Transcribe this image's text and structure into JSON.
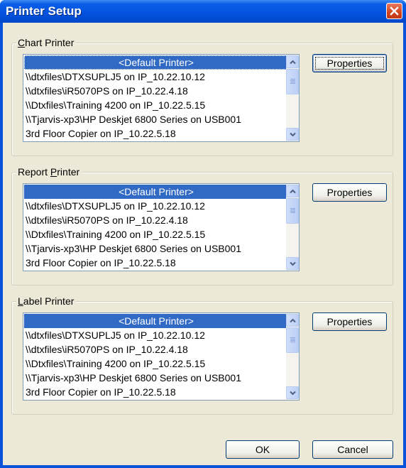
{
  "window": {
    "title": "Printer Setup"
  },
  "printers": [
    "<Default Printer>",
    "\\\\dtxfiles\\DTXSUPLJ5 on IP_10.22.10.12",
    "\\\\dtxfiles\\iR5070PS on IP_10.22.4.18",
    "\\\\Dtxfiles\\Training 4200 on IP_10.22.5.15",
    "\\\\Tjarvis-xp3\\HP Deskjet 6800 Series on USB001",
    "3rd Floor Copier on IP_10.22.5.18"
  ],
  "groups": {
    "chart": {
      "label_pre": "",
      "label_acc": "C",
      "label_post": "hart Printer",
      "properties_label": "Properties",
      "selected": "<Default Printer>"
    },
    "report": {
      "label_pre": "Report ",
      "label_acc": "P",
      "label_post": "rinter",
      "properties_label": "Properties",
      "selected": "<Default Printer>"
    },
    "label": {
      "label_pre": "",
      "label_acc": "L",
      "label_post": "abel Printer",
      "properties_label": "Properties",
      "selected": "<Default Printer>"
    }
  },
  "footer": {
    "ok_label": "OK",
    "cancel_label": "Cancel"
  },
  "icons": {
    "close": "close-icon",
    "scroll_up": "scroll-up-arrow-icon",
    "scroll_down": "scroll-down-arrow-icon"
  },
  "colors": {
    "title_bar": "#0353e0",
    "selection": "#316ac5",
    "dialog_bg": "#ece9d8",
    "close": "#d2431e"
  }
}
